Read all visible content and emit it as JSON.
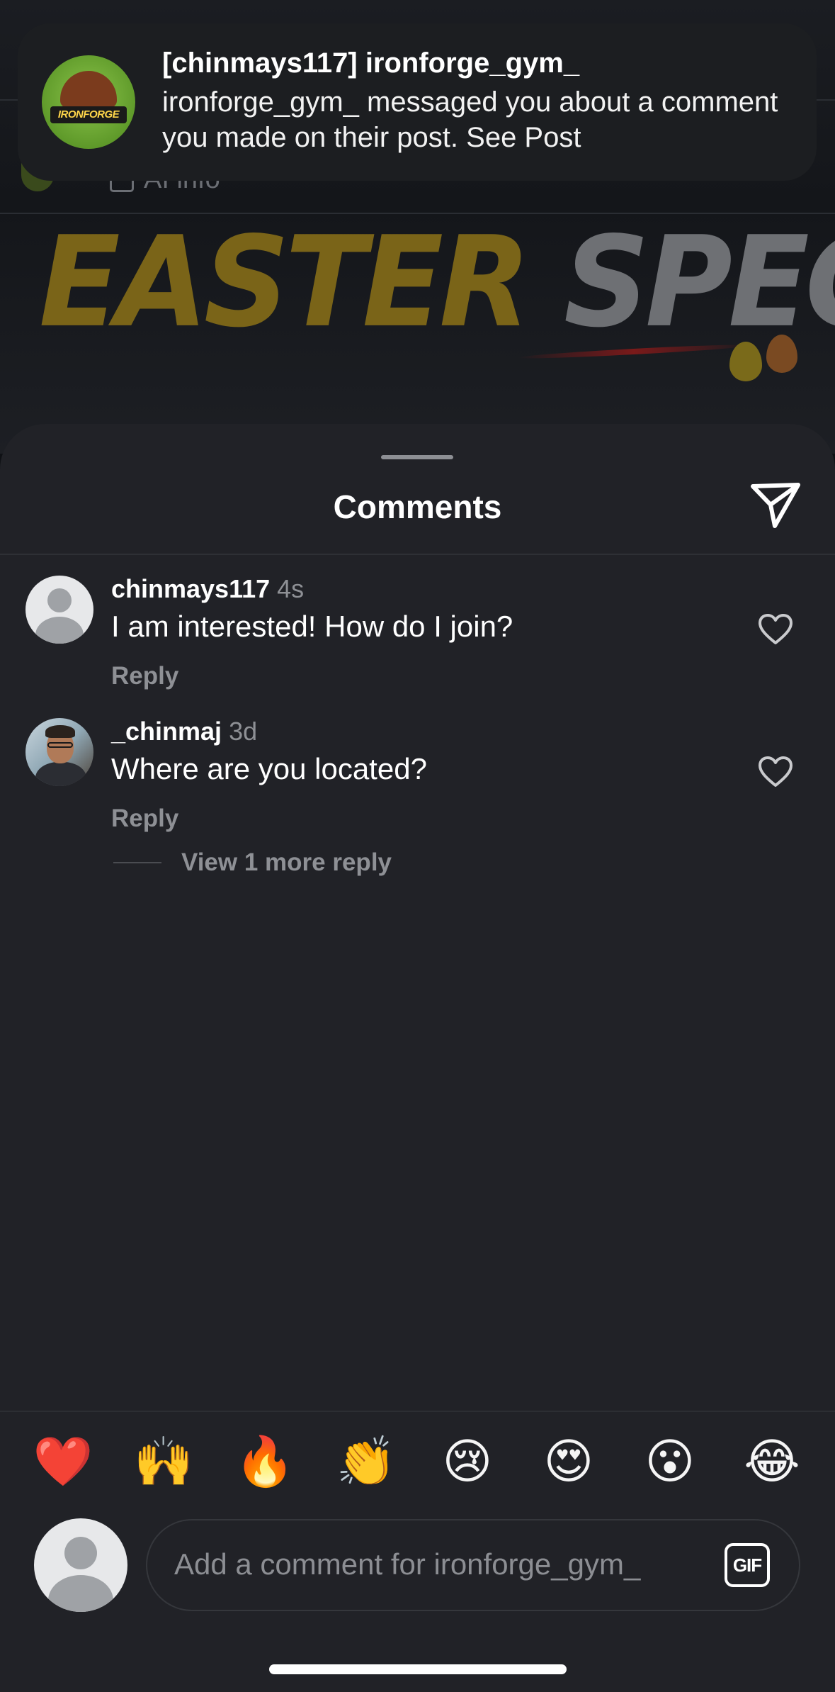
{
  "notification": {
    "title": "[chinmays117] ironforge_gym_",
    "body": "ironforge_gym_ messaged you about a comment you made on their post. See Post",
    "logo_text": "IRONFORGE"
  },
  "post": {
    "ai_info_label": "AI info",
    "headline_word1": "EASTER",
    "headline_word2": "SPECIAL"
  },
  "sheet": {
    "title": "Comments",
    "share_icon": "paper-plane-icon"
  },
  "comments": [
    {
      "username": "chinmays117",
      "time": "4s",
      "text": "I am interested! How do I join?",
      "reply_label": "Reply"
    },
    {
      "username": "_chinmaj",
      "time": "3d",
      "text": "Where are you located?",
      "reply_label": "Reply",
      "more_replies": "View 1 more reply"
    }
  ],
  "emojis": [
    "❤️",
    "🙌",
    "🔥",
    "👏",
    "😢",
    "😍",
    "😮",
    "😂"
  ],
  "composer": {
    "placeholder": "Add a comment for ironforge_gym_",
    "gif_label": "GIF"
  },
  "colors": {
    "sheet_bg": "#212227",
    "muted_text": "#8e9095",
    "banner_bg": "#1c1e21"
  }
}
